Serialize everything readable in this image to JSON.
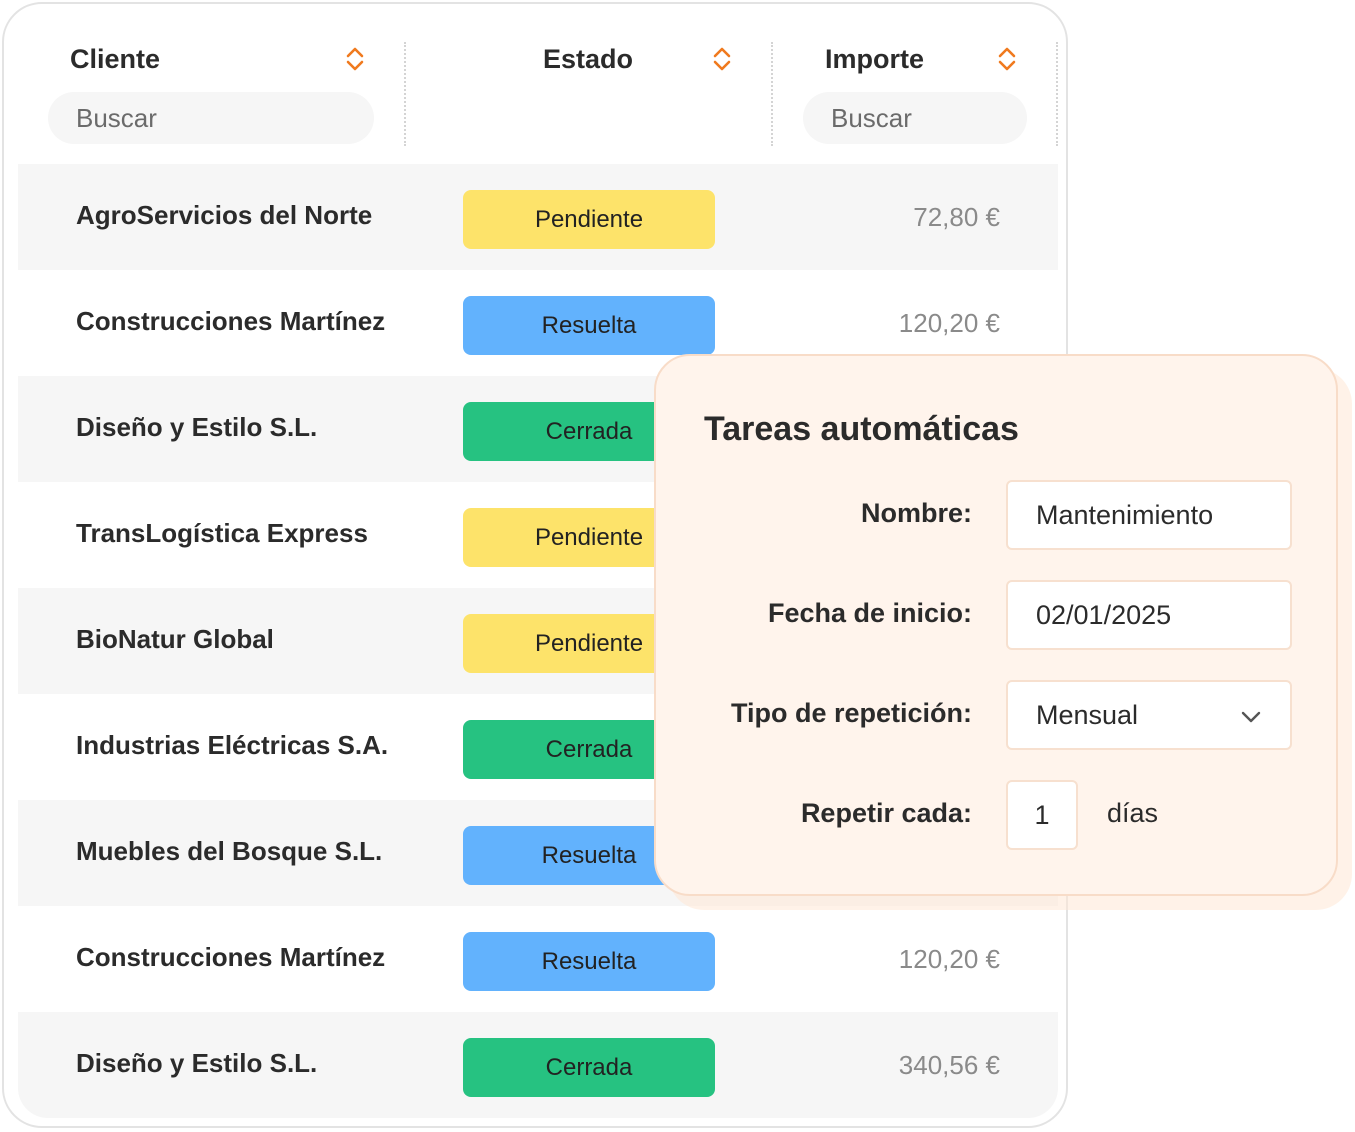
{
  "table": {
    "columns": [
      {
        "label": "Cliente",
        "search_placeholder": "Buscar"
      },
      {
        "label": "Estado"
      },
      {
        "label": "Importe",
        "search_placeholder": "Buscar"
      }
    ],
    "rows": [
      {
        "client": "AgroServicios del Norte",
        "status": "Pendiente",
        "amount": "72,80 €"
      },
      {
        "client": "Construcciones Martínez",
        "status": "Resuelta",
        "amount": "120,20 €"
      },
      {
        "client": "Diseño y Estilo S.L.",
        "status": "Cerrada",
        "amount": ""
      },
      {
        "client": "TransLogística Express",
        "status": "Pendiente",
        "amount": ""
      },
      {
        "client": "BioNatur Global",
        "status": "Pendiente",
        "amount": ""
      },
      {
        "client": "Industrias Eléctricas S.A.",
        "status": "Cerrada",
        "amount": ""
      },
      {
        "client": "Muebles del Bosque S.L.",
        "status": "Resuelta",
        "amount": ""
      },
      {
        "client": "Construcciones Martínez",
        "status": "Resuelta",
        "amount": "120,20 €"
      },
      {
        "client": "Diseño y Estilo S.L.",
        "status": "Cerrada",
        "amount": "340,56 €"
      }
    ]
  },
  "status_colors": {
    "Pendiente": "#fde36a",
    "Resuelta": "#62b2fd",
    "Cerrada": "#26c281"
  },
  "accent_color": "#f07a1e",
  "modal": {
    "title": "Tareas automáticas",
    "fields": {
      "name_label": "Nombre:",
      "name_value": "Mantenimiento",
      "start_label": "Fecha de inicio:",
      "start_value": "02/01/2025",
      "repeat_type_label": "Tipo de repetición:",
      "repeat_type_value": "Mensual",
      "repeat_every_label": "Repetir cada:",
      "repeat_every_value": "1",
      "repeat_every_unit": "días"
    }
  }
}
